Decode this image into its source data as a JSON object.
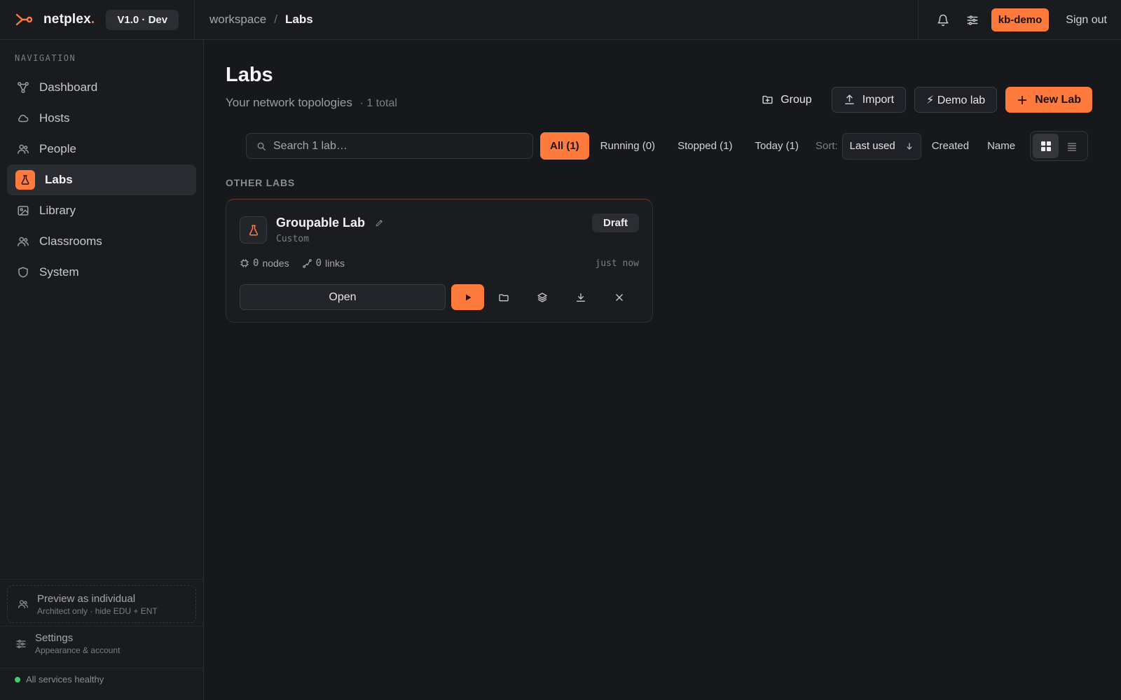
{
  "brand": {
    "name": "netplex",
    "dot": ".",
    "version": "V1.0 · Dev"
  },
  "breadcrumb": {
    "workspace": "workspace",
    "separator": "/",
    "current": "Labs"
  },
  "topbar": {
    "user": "kb-demo",
    "signout": "Sign out",
    "icons": [
      "bell-icon",
      "sliders-icon"
    ]
  },
  "sidebar": {
    "heading": "NAVIGATION",
    "items": [
      {
        "label": "Dashboard",
        "icon": "topology-icon"
      },
      {
        "label": "Hosts",
        "icon": "cloud-icon"
      },
      {
        "label": "People",
        "icon": "people-icon"
      },
      {
        "label": "Labs",
        "icon": "flask-icon",
        "active": true
      },
      {
        "label": "Library",
        "icon": "image-icon"
      },
      {
        "label": "Classrooms",
        "icon": "people-icon"
      },
      {
        "label": "System",
        "icon": "shield-icon"
      }
    ],
    "preview": {
      "title": "Preview as individual",
      "subtitle": "Architect only · hide EDU + ENT"
    },
    "settings": {
      "title": "Settings",
      "subtitle": "Appearance & account"
    },
    "health": "All services healthy"
  },
  "page": {
    "title": "Labs",
    "subtitle": "Your network topologies",
    "count": "· 1 total"
  },
  "actions": {
    "group": "Group",
    "import": "Import",
    "demo": "⚡ Demo lab",
    "new": "New Lab"
  },
  "search": {
    "placeholder": "Search 1 lab…",
    "value": ""
  },
  "filters": {
    "all": "All (1)",
    "running": "Running (0)",
    "stopped": "Stopped (1)",
    "today": "Today (1)"
  },
  "sort": {
    "label": "Sort:",
    "selected": "Last used",
    "created": "Created",
    "name": "Name"
  },
  "view": {
    "active": "grid"
  },
  "section": {
    "title": "OTHER LABS"
  },
  "lab_card": {
    "title": "Groupable Lab",
    "type": "Custom",
    "status": "Draft",
    "nodes_count": "0",
    "nodes_label": "nodes",
    "links_count": "0",
    "links_label": "links",
    "time": "just now",
    "open_label": "Open"
  },
  "colors": {
    "accent": "#ff7a3d",
    "background": "#17181b",
    "health": "#3ccf6e"
  }
}
